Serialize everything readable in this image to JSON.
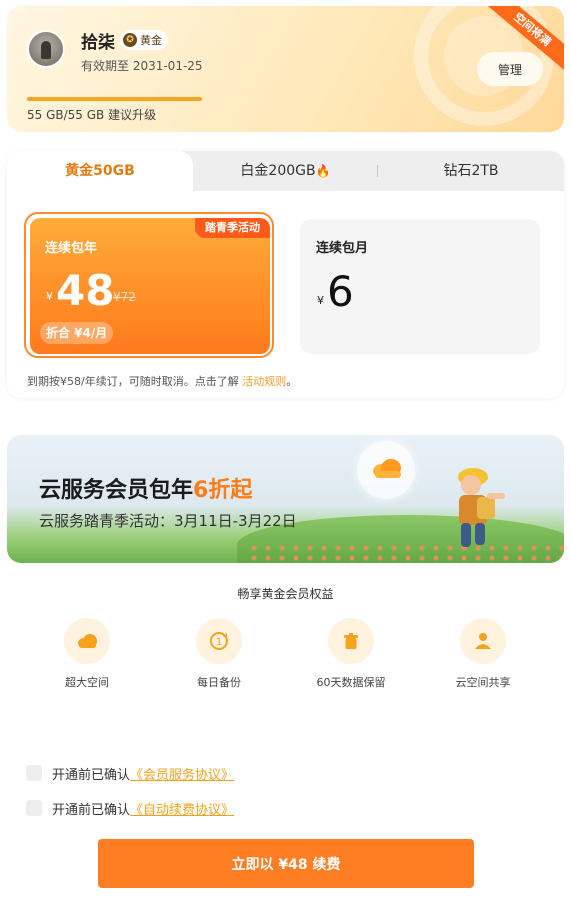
{
  "member": {
    "name": "拾柒",
    "badge": "黄金",
    "expiry": "有效期至 2031-01-25",
    "manage_label": "管理",
    "corner_ribbon": "空间将满",
    "storage_text": "55 GB/55 GB 建议升级"
  },
  "tabs": [
    {
      "label": "黄金50GB"
    },
    {
      "label": "白金200GB"
    },
    {
      "label": "钻石2TB"
    }
  ],
  "plans": {
    "active": {
      "title": "连续包年",
      "currency": "¥",
      "price": "48",
      "original": "¥72",
      "promo_tag": "踏青季活动",
      "monthly": "折合 ¥4/月"
    },
    "monthly": {
      "title": "连续包月",
      "currency": "¥",
      "price": "6"
    },
    "note_text": "到期按¥58/年续订，可随时取消。点击了解 ",
    "note_link": "活动规则",
    "note_end": "。"
  },
  "banner": {
    "title_prefix": "云服务会员包年",
    "title_highlight": "6折起",
    "subtitle": "云服务踏青季活动：3月11日-3月22日"
  },
  "benefits": {
    "title": "畅享黄金会员权益",
    "items": [
      {
        "label": "超大空间",
        "icon": "cloud-icon"
      },
      {
        "label": "每日备份",
        "icon": "backup-icon"
      },
      {
        "label": "60天数据保留",
        "icon": "trash-icon"
      },
      {
        "label": "云空间共享",
        "icon": "user-share-icon"
      }
    ]
  },
  "agreements": [
    {
      "prefix": "开通前已确认",
      "link": "《会员服务协议》"
    },
    {
      "prefix": "开通前已确认",
      "link": "《自动续费协议》"
    }
  ],
  "cta_label": "立即以 ¥48 续费",
  "colors": {
    "accent": "#ff7d23",
    "gold_text": "#e47b12",
    "link": "#f2a11f"
  }
}
